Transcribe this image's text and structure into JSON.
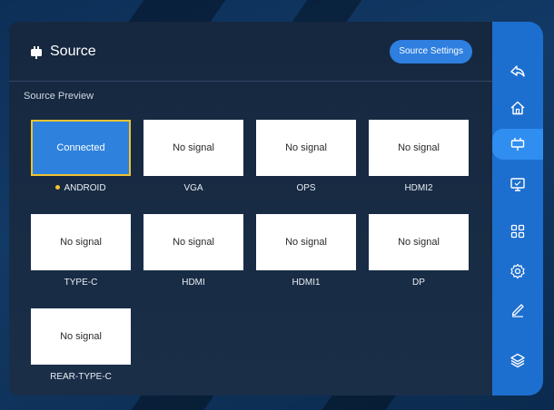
{
  "header": {
    "title": "Source",
    "settings_button": "Source Settings"
  },
  "preview_label": "Source Preview",
  "sources": [
    {
      "name": "ANDROID",
      "status": "Connected",
      "active": true
    },
    {
      "name": "VGA",
      "status": "No signal",
      "active": false
    },
    {
      "name": "OPS",
      "status": "No signal",
      "active": false
    },
    {
      "name": "HDMI2",
      "status": "No signal",
      "active": false
    },
    {
      "name": "TYPE-C",
      "status": "No signal",
      "active": false
    },
    {
      "name": "HDMI",
      "status": "No signal",
      "active": false
    },
    {
      "name": "HDMI1",
      "status": "No signal",
      "active": false
    },
    {
      "name": "DP",
      "status": "No signal",
      "active": false
    },
    {
      "name": "REAR-TYPE-C",
      "status": "No signal",
      "active": false
    }
  ],
  "sidebar": {
    "items": [
      {
        "icon": "back-icon"
      },
      {
        "icon": "home-icon"
      },
      {
        "icon": "source-icon",
        "active": true
      },
      {
        "icon": "screen-icon"
      },
      {
        "icon": "apps-icon"
      },
      {
        "icon": "settings-icon"
      },
      {
        "icon": "pen-icon"
      },
      {
        "icon": "layers-icon"
      }
    ]
  },
  "colors": {
    "accent": "#2e82dd",
    "highlight_border": "#f2c230",
    "sidebar": "#1d6fcf",
    "panel": "#16283f"
  }
}
